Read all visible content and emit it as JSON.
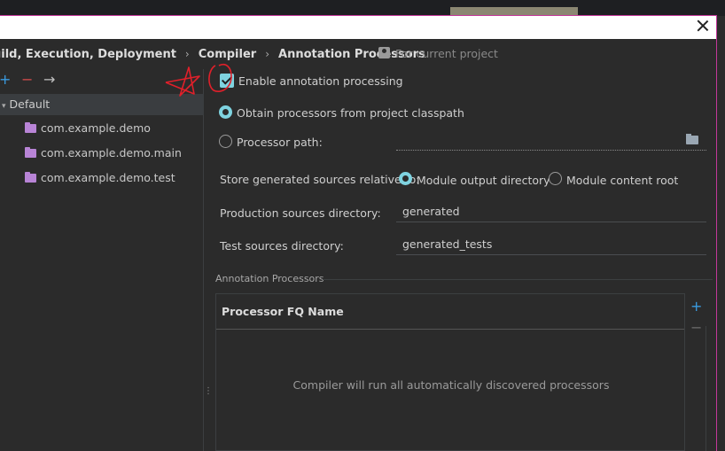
{
  "breadcrumb": {
    "items": [
      "uild, Execution, Deployment",
      "Compiler",
      "Annotation Processors"
    ],
    "separator": "›",
    "scope_label": "For current project"
  },
  "left": {
    "toolbar": {
      "add": "+",
      "remove": "−",
      "move": "→"
    },
    "tree": {
      "root": "Default",
      "modules": [
        "com.example.demo",
        "com.example.demo.main",
        "com.example.demo.test"
      ]
    }
  },
  "right": {
    "enable_label": "Enable annotation processing",
    "enable_checked": true,
    "obtain_classpath_label": "Obtain processors from project classpath",
    "processor_path_label": "Processor path:",
    "store_label": "Store generated sources relative to:",
    "store_opt_output": "Module output directory",
    "store_opt_content": "Module content root",
    "prod_dir_label": "Production sources directory:",
    "prod_dir_value": "generated",
    "test_dir_label": "Test sources directory:",
    "test_dir_value": "generated_tests",
    "section_title": "Annotation Processors",
    "table_header": "Processor FQ Name",
    "table_empty": "Compiler will run all automatically discovered processors",
    "add": "+",
    "remove": "−"
  },
  "colors": {
    "accent": "#7fd3e0",
    "folder": "#b884d6",
    "annotation": "#e0202a"
  }
}
